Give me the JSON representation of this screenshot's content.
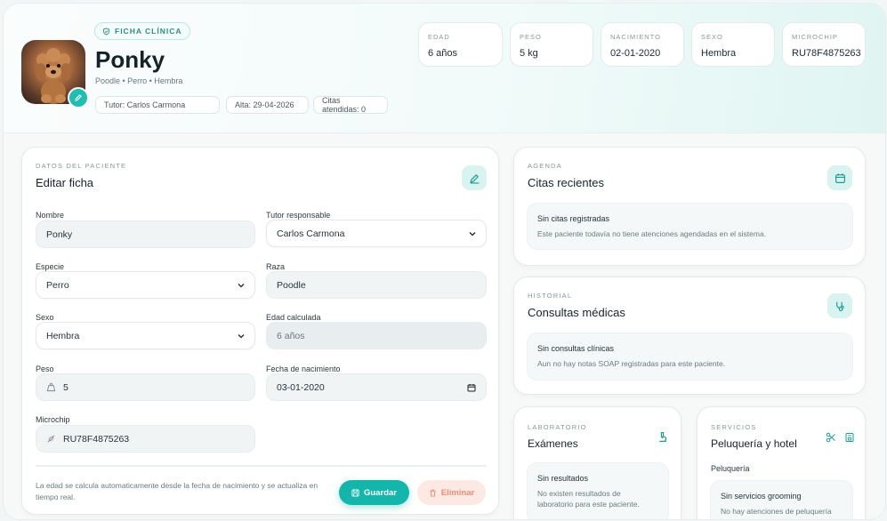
{
  "colors": {
    "accent": "#14b5aa",
    "accent_soft": "#d9f4f0",
    "danger": "#ef8c74",
    "danger_soft": "#fde9e4"
  },
  "header": {
    "badge": "FICHA CLÍNICA",
    "name": "Ponky",
    "subtitle": "Poodle • Perro • Hembra",
    "pills": [
      "Tutor: Carlos Carmona",
      "Alta: 29-04-2026",
      "Citas atendidas: 0"
    ],
    "stats": [
      {
        "key": "EDAD",
        "value": "6 años"
      },
      {
        "key": "PESO",
        "value": "5 kg"
      },
      {
        "key": "NACIMIENTO",
        "value": "02-01-2020"
      },
      {
        "key": "SEXO",
        "value": "Hembra"
      },
      {
        "key": "MICROCHIP",
        "value": "RU78F4875263"
      }
    ]
  },
  "form": {
    "eyebrow": "DATOS DEL PACIENTE",
    "title": "Editar ficha",
    "fields": {
      "nombre": {
        "label": "Nombre",
        "value": "Ponky"
      },
      "tutor": {
        "label": "Tutor responsable",
        "value": "Carlos Carmona"
      },
      "especie": {
        "label": "Especie",
        "value": "Perro"
      },
      "raza": {
        "label": "Raza",
        "value": "Poodle"
      },
      "sexo": {
        "label": "Sexo",
        "value": "Hembra"
      },
      "edad": {
        "label": "Edad calculada",
        "value": "6 años"
      },
      "peso": {
        "label": "Peso",
        "value": "5"
      },
      "nacimiento": {
        "label": "Fecha de nacimiento",
        "value": "03-01-2020"
      },
      "microchip": {
        "label": "Microchip",
        "value": "RU78F4875263"
      }
    },
    "note": "La edad se calcula automaticamente desde la fecha de nacimiento y se actualiza en tiempo real.",
    "save_label": "Guardar",
    "delete_label": "Eliminar"
  },
  "agenda": {
    "eyebrow": "AGENDA",
    "title": "Citas recientes",
    "empty_title": "Sin citas registradas",
    "empty_desc": "Este paciente todavía no tiene atenciones agendadas en el sistema."
  },
  "historial": {
    "eyebrow": "HISTORIAL",
    "title": "Consultas médicas",
    "empty_title": "Sin consultas clínicas",
    "empty_desc": "Aun no hay notas SOAP registradas para este paciente."
  },
  "laboratorio": {
    "eyebrow": "LABORATORIO",
    "title": "Exámenes",
    "empty_title": "Sin resultados",
    "empty_desc": "No existen resultados de laboratorio para este paciente."
  },
  "servicios": {
    "eyebrow": "SERVICIOS",
    "title": "Peluquería y hotel",
    "section": "Peluquería",
    "empty_title": "Sin servicios grooming",
    "empty_desc": "No hay atenciones de peluquería registradas."
  }
}
